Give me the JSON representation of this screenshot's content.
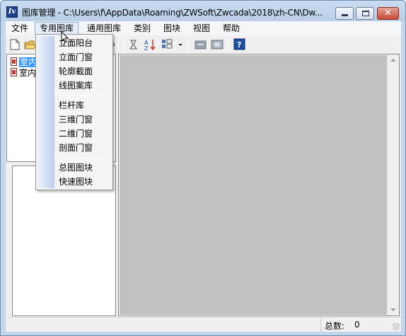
{
  "window": {
    "title": "图库管理 - C:\\Users\\f\\AppData\\Roaming\\ZWSoft\\Zwcada\\2018\\zh-CN\\Dw...",
    "app_icon_glyph": "Iv",
    "close_glyph": "✕"
  },
  "menubar": {
    "items": [
      "文件",
      "专用图库",
      "通用图库",
      "类别",
      "图块",
      "视图",
      "帮助"
    ],
    "active_index": 1
  },
  "toolbar": {
    "icons": [
      "new-icon",
      "open-icon",
      "save-icon",
      "rename-icon",
      "delete-icon",
      "filter-icon",
      "sort-icon",
      "view-mode-icon",
      "view-dropdown-icon",
      "insert-block-icon",
      "replace-block-icon",
      "help-icon"
    ]
  },
  "tree": {
    "items": [
      {
        "label": "室内",
        "selected": true
      },
      {
        "label": "室内",
        "selected": false
      }
    ]
  },
  "dropdown": {
    "groups": [
      [
        "立面阳台",
        "立面门窗",
        "轮廓截面",
        "线图案库"
      ],
      [
        "栏杆库",
        "三维门窗",
        "二维门窗",
        "剖面门窗"
      ],
      [
        "总图图块",
        "快速图块"
      ]
    ]
  },
  "statusbar": {
    "count_label": "总数:",
    "count_value": "0"
  },
  "colors": {
    "title_gradient_top": "#c9dcf0",
    "selection": "#3399ff",
    "canvas": "#c0c0c0",
    "close_button": "#c74a36"
  }
}
